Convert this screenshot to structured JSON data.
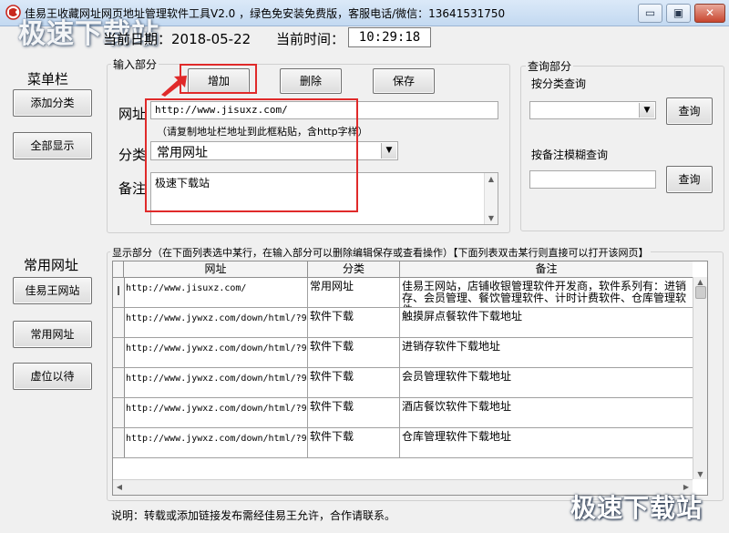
{
  "window": {
    "title": "佳易王收藏网址网页地址管理软件工具V2.0 ，绿色免安装免费版，客服电话/微信：13641531750",
    "minimize": "▭",
    "maximize": "▣",
    "close": "✕"
  },
  "watermark": {
    "text": "极速下载站"
  },
  "status": {
    "date_label": "当前日期：2018-05-22",
    "time_label": "当前时间：",
    "time_value": "10:29:18"
  },
  "sidebar": {
    "menu_title": "菜单栏",
    "add_category": "添加分类",
    "show_all": "全部显示",
    "common_title": "常用网址",
    "links": [
      "佳易王网站",
      "常用网址",
      "虚位以待"
    ]
  },
  "input_section": {
    "label": "输入部分",
    "add_button": "增加",
    "delete_button": "删除",
    "save_button": "保存",
    "url_label": "网址",
    "url_value": "http://www.jisuxz.com/",
    "url_hint": "（请复制地址栏地址到此框粘贴，含http字样）",
    "category_label": "分类",
    "category_value": "常用网址",
    "note_label": "备注",
    "note_value": "极速下载站"
  },
  "query_section": {
    "label": "查询部分",
    "by_category_label": "按分类查询",
    "query_button_1": "查询",
    "by_note_label": "按备注模糊查询",
    "query_button_2": "查询"
  },
  "display_section": {
    "label": "显示部分（在下面列表选中某行，在输入部分可以删除编辑保存或查看操作）【下面列表双击某行则直接可以打开该网页】",
    "columns": [
      "网址",
      "分类",
      "备注"
    ],
    "rows": [
      {
        "marker": "I",
        "url": "http://www.jisuxz.com/",
        "category": "常用网址",
        "note": "佳易王网站，店铺收银管理软件开发商，软件系列有：进销存、会员管理、餐饮管理软件、计时计费软件、仓库管理软件"
      },
      {
        "marker": "",
        "url": "http://www.jywxz.com/down/html/?9",
        "category": "软件下载",
        "note": "触摸屏点餐软件下载地址"
      },
      {
        "marker": "",
        "url": "http://www.jywxz.com/down/html/?9",
        "category": "软件下载",
        "note": "进销存软件下载地址"
      },
      {
        "marker": "",
        "url": "http://www.jywxz.com/down/html/?9",
        "category": "软件下载",
        "note": "会员管理软件下载地址"
      },
      {
        "marker": "",
        "url": "http://www.jywxz.com/down/html/?9",
        "category": "软件下载",
        "note": "酒店餐饮软件下载地址"
      },
      {
        "marker": "",
        "url": "http://www.jywxz.com/down/html/?9",
        "category": "软件下载",
        "note": "仓库管理软件下载地址"
      }
    ]
  },
  "footer": {
    "note": "说明：转载或添加链接发布需经佳易王允许，合作请联系。"
  },
  "colors": {
    "highlight_red": "#e02a2a",
    "titlebar": "#c3d9f1"
  }
}
